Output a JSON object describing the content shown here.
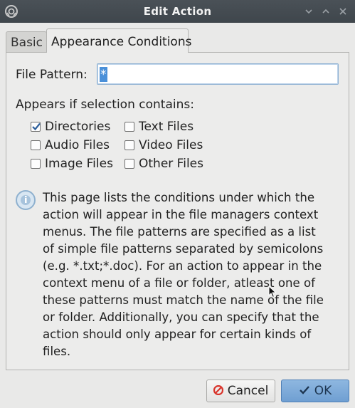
{
  "window": {
    "title": "Edit Action"
  },
  "tabs": [
    {
      "label": "Basic",
      "active": false
    },
    {
      "label": "Appearance Conditions",
      "active": true
    }
  ],
  "file_pattern": {
    "label": "File Pattern:",
    "value": "*"
  },
  "appears_label": "Appears if selection contains:",
  "checkboxes": [
    {
      "label": "Directories",
      "checked": true
    },
    {
      "label": "Text Files",
      "checked": false
    },
    {
      "label": "Audio Files",
      "checked": false
    },
    {
      "label": "Video Files",
      "checked": false
    },
    {
      "label": "Image Files",
      "checked": false
    },
    {
      "label": "Other Files",
      "checked": false
    }
  ],
  "info_text": "This page lists the conditions under which the\naction will appear in the file managers context\nmenus. The file patterns are specified as a list\nof simple file patterns separated by semicolons\n(e.g. *.txt;*.doc). For an action to appear in the\ncontext menu of a file or folder, atleast one of\nthese patterns must match the name of the file\nor folder. Additionally, you can specify that the\naction should only appear for certain kinds of\nfiles.",
  "buttons": {
    "cancel": "Cancel",
    "ok": "OK"
  },
  "colors": {
    "titlebar": "#3f464c",
    "selection": "#4a90d9",
    "ok_button": "#7aa7d8",
    "cancel_icon": "#d9342b"
  }
}
